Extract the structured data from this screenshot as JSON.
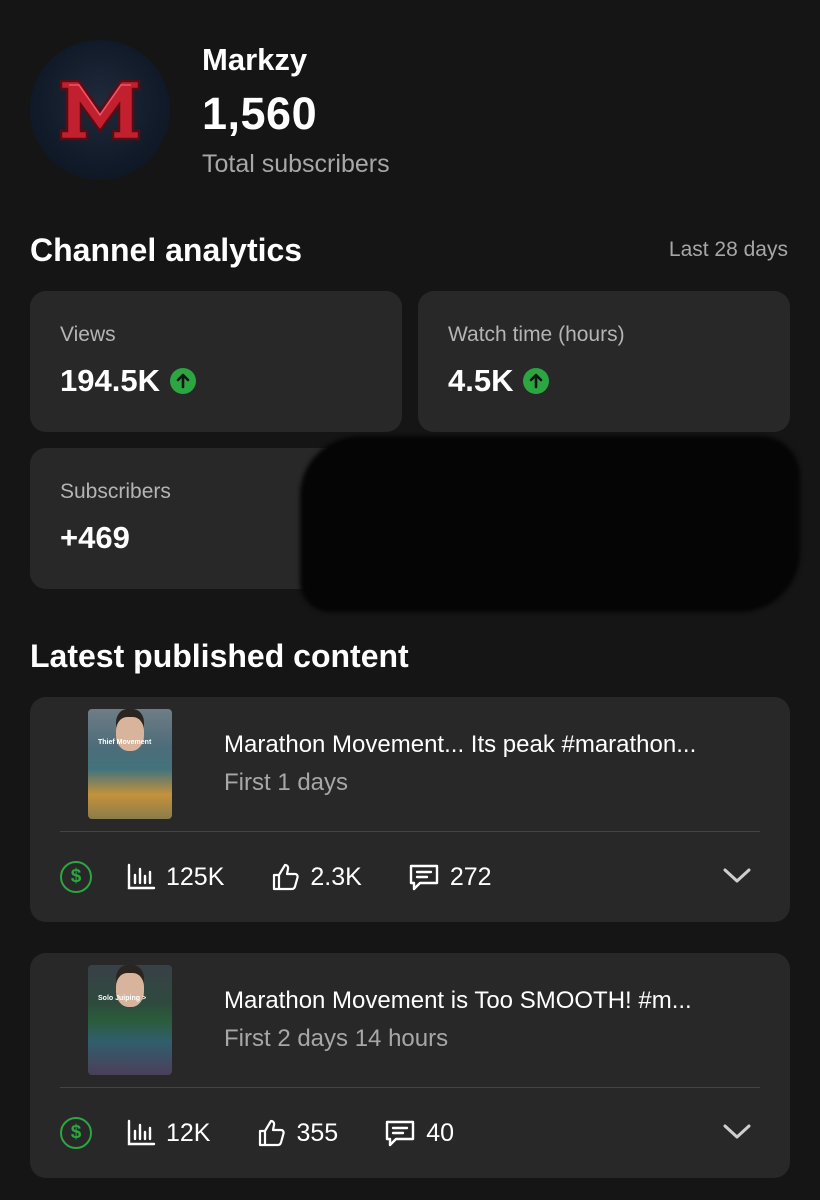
{
  "channel": {
    "name": "Markzy",
    "subscribers": "1,560",
    "subscribers_label": "Total subscribers",
    "avatar_letter": "M"
  },
  "analytics": {
    "title": "Channel analytics",
    "range": "Last 28 days",
    "metrics": [
      {
        "label": "Views",
        "value": "194.5K",
        "trend": "up"
      },
      {
        "label": "Watch time (hours)",
        "value": "4.5K",
        "trend": "up"
      },
      {
        "label": "Subscribers",
        "value": "+469",
        "trend": ""
      }
    ]
  },
  "latest": {
    "title": "Latest published content",
    "items": [
      {
        "title": "Marathon Movement... Its peak  #marathon...",
        "subtitle": "First 1 days",
        "thumb_text": "Thief Movement",
        "monetization_icon": "dollar-circle-icon",
        "views": "125K",
        "likes": "2.3K",
        "comments": "272"
      },
      {
        "title": "Marathon Movement is Too SMOOTH!  #m...",
        "subtitle": "First 2 days 14 hours",
        "thumb_text": "Solo Juiping >",
        "monetization_icon": "dollar-circle-icon",
        "views": "12K",
        "likes": "355",
        "comments": "40"
      }
    ]
  },
  "colors": {
    "background": "#151515",
    "card": "#282828",
    "accent_green": "#2ba640",
    "secondary_text": "#a7a7a7"
  }
}
